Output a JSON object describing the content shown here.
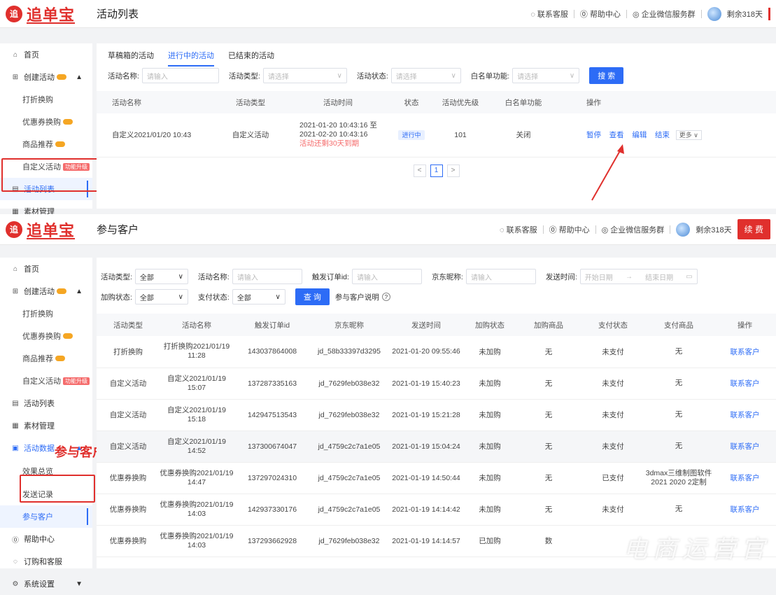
{
  "brand": {
    "badge": "追",
    "name": "追单宝"
  },
  "top_links": {
    "service": "联系客服",
    "help": "帮助中心",
    "wechat": "企业微信服务群",
    "remaining": "剩余318天",
    "renew": "续 费"
  },
  "panel1": {
    "title": "活动列表",
    "sidebar": {
      "home": "首页",
      "create": "创建活动",
      "discount": "打折换购",
      "coupon": "优惠券换购",
      "recommend": "商品推荐",
      "custom": "自定义活动",
      "custom_tag": "功能升级",
      "list": "活动列表",
      "material": "素材管理"
    },
    "tabs": [
      "草稿箱的活动",
      "进行中的活动",
      "已结束的活动"
    ],
    "filters": {
      "name_label": "活动名称:",
      "name_ph": "请输入",
      "type_label": "活动类型:",
      "type_ph": "请选择",
      "status_label": "活动状态:",
      "status_ph": "请选择",
      "white_label": "白名单功能:",
      "white_ph": "请选择",
      "search": "搜 索"
    },
    "columns": [
      "活动名称",
      "活动类型",
      "活动时间",
      "状态",
      "活动优先级",
      "白名单功能",
      "操作"
    ],
    "row": {
      "name": "自定义2021/01/20 10:43",
      "type": "自定义活动",
      "time1": "2021-01-20 10:43:16 至",
      "time2": "2021-02-20 10:43:16",
      "time3": "活动还剩30天到期",
      "status": "进行中",
      "priority": "101",
      "white": "关闭",
      "ops": [
        "暂停",
        "查看",
        "编辑",
        "结束"
      ],
      "more": "更多 ∨"
    },
    "page": "1"
  },
  "panel2": {
    "title": "参与客户",
    "sidebar": {
      "home": "首页",
      "create": "创建活动",
      "discount": "打折换购",
      "coupon": "优惠券换购",
      "recommend": "商品推荐",
      "custom": "自定义活动",
      "custom_tag": "功能升级",
      "list": "活动列表",
      "material": "素材管理",
      "data": "活动数据",
      "overview": "效果总览",
      "send": "发送记录",
      "customers": "参与客户",
      "help": "帮助中心",
      "order": "订购和客服",
      "settings": "系统设置"
    },
    "callout": "参与客户",
    "filters": {
      "type_label": "活动类型:",
      "type_val": "全部",
      "name_label": "活动名称:",
      "name_ph": "请输入",
      "order_label": "触发订单id:",
      "order_ph": "请输入",
      "jd_label": "京东昵称:",
      "jd_ph": "请输入",
      "time_label": "发送时间:",
      "start_ph": "开始日期",
      "arrow": "→",
      "end_ph": "结束日期",
      "add_label": "加购状态:",
      "add_val": "全部",
      "pay_label": "支付状态:",
      "pay_val": "全部",
      "query": "查 询",
      "explain": "参与客户说明",
      "q_icon": "?"
    },
    "columns": [
      "活动类型",
      "活动名称",
      "触发订单id",
      "京东昵称",
      "发送时间",
      "加购状态",
      "加购商品",
      "支付状态",
      "支付商品",
      "操作"
    ],
    "rows": [
      [
        "打折换购",
        "打折换购2021/01/19 11:28",
        "143037864008",
        "jd_58b33397d3295",
        "2021-01-20 09:55:46",
        "未加购",
        "无",
        "未支付",
        "无",
        "联系客户"
      ],
      [
        "自定义活动",
        "自定义2021/01/19 15:07",
        "137287335163",
        "jd_7629feb038e32",
        "2021-01-19 15:40:23",
        "未加购",
        "无",
        "未支付",
        "无",
        "联系客户"
      ],
      [
        "自定义活动",
        "自定义2021/01/19 15:18",
        "142947513543",
        "jd_7629feb038e32",
        "2021-01-19 15:21:28",
        "未加购",
        "无",
        "未支付",
        "无",
        "联系客户"
      ],
      [
        "自定义活动",
        "自定义2021/01/19 14:52",
        "137300674047",
        "jd_4759c2c7a1e05",
        "2021-01-19 15:04:24",
        "未加购",
        "无",
        "未支付",
        "无",
        "联系客户"
      ],
      [
        "优惠券换购",
        "优惠券换购2021/01/19 14:47",
        "137297024310",
        "jd_4759c2c7a1e05",
        "2021-01-19 14:50:44",
        "未加购",
        "无",
        "已支付",
        "3dmax三维制图软件 2021 2020 2定制",
        "联系客户"
      ],
      [
        "优惠券换购",
        "优惠券换购2021/01/19 14:03",
        "142937330176",
        "jd_4759c2c7a1e05",
        "2021-01-19 14:14:42",
        "未加购",
        "无",
        "未支付",
        "无",
        "联系客户"
      ],
      [
        "优惠券换购",
        "优惠券换购2021/01/19 14:03",
        "137293662928",
        "jd_7629feb038e32",
        "2021-01-19 14:14:57",
        "已加购",
        "数",
        "",
        "",
        ""
      ]
    ]
  },
  "watermark": "电商运营官"
}
